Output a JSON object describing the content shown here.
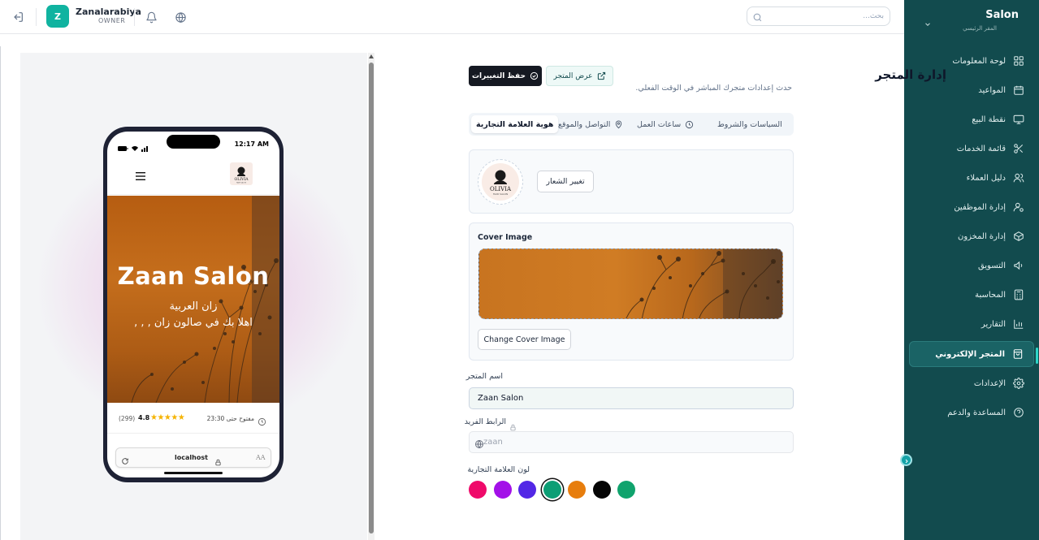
{
  "header": {
    "user_initial": "Z",
    "user_name": "Zanalarabiya",
    "user_role": "OWNER",
    "search_placeholder": "بحث..."
  },
  "sidebar": {
    "brand": "Salon",
    "brand_sub": "المقر الرئيسي",
    "items": [
      {
        "label": "لوحة المعلومات",
        "icon": "dashboard-icon"
      },
      {
        "label": "المواعيد",
        "icon": "calendar-icon"
      },
      {
        "label": "نقطة البيع",
        "icon": "monitor-icon"
      },
      {
        "label": "قائمة الخدمات",
        "icon": "scissors-icon"
      },
      {
        "label": "دليل العملاء",
        "icon": "users-icon"
      },
      {
        "label": "إدارة الموظفين",
        "icon": "user-settings-icon"
      },
      {
        "label": "إدارة المخزون",
        "icon": "box-icon"
      },
      {
        "label": "التسويق",
        "icon": "megaphone-icon"
      },
      {
        "label": "المحاسبة",
        "icon": "calculator-icon"
      },
      {
        "label": "التقارير",
        "icon": "bar-chart-icon"
      },
      {
        "label": "المتجر الإلكتروني",
        "icon": "shopping-bag-icon",
        "active": true
      },
      {
        "label": "الإعدادات",
        "icon": "gear-icon"
      },
      {
        "label": "المساعدة والدعم",
        "icon": "help-icon"
      }
    ]
  },
  "preview": {
    "status_time": "12:17 AM",
    "logo_text": "OLIVIA",
    "logo_sub": "HAIR SALON",
    "store_title": "Zaan Salon",
    "hero_line1": "زان العربية",
    "hero_line2": "اهلا بك في صالون زان , , ,",
    "open_text": "مفتوح حتى 23:30",
    "rating": "4.8",
    "rating_count": "(299)",
    "url": "localhost",
    "text_size": "AA"
  },
  "page": {
    "title": "إدارة المتجر",
    "subtitle": "حدث إعدادات متجرك المباشر في الوقت الفعلي.",
    "save_label": "حفظ التغييرات",
    "view_label": "عرض المتجر"
  },
  "tabs": [
    {
      "label": "هوية العلامة التجارية",
      "active": true
    },
    {
      "label": "التواصل والموقع"
    },
    {
      "label": "ساعات العمل"
    },
    {
      "label": "السياسات والشروط"
    }
  ],
  "form": {
    "change_logo": "تغيير الشعار",
    "logo_text": "OLIVIA",
    "logo_sub": "HAIR SALON",
    "cover_label": "Cover Image",
    "change_cover": "Change Cover Image",
    "store_name_label": "اسم المتجر",
    "store_name_value": "Zaan Salon",
    "slug_label": "الرابط الفريد",
    "slug_value": "zaan",
    "brand_color_label": "لون العلامة التجارية",
    "colors": [
      "#ef0a6a",
      "#a310e8",
      "#5227e6",
      "#0d9e75",
      "#e77d0d",
      "#050505",
      "#10a36d"
    ],
    "selected_color": "#0d9e75"
  }
}
